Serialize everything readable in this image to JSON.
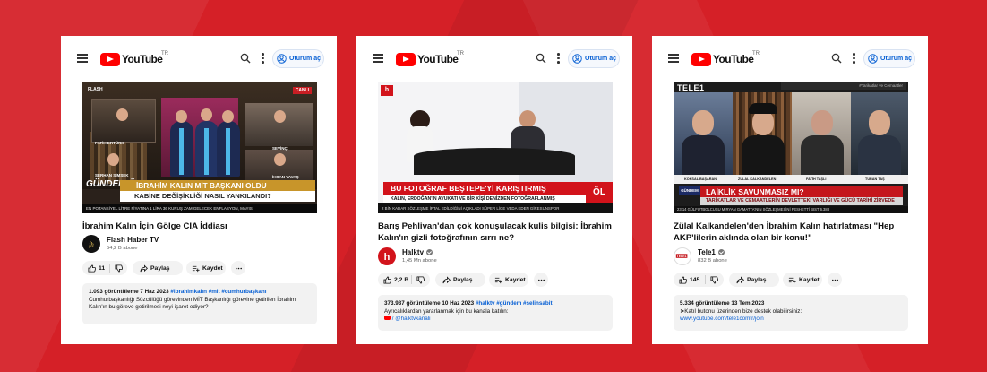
{
  "colors": {
    "background": "#d52027",
    "yt_red": "#ff0000",
    "link_blue": "#065fd4"
  },
  "icons": [
    "menu-icon",
    "youtube-logo",
    "search-icon",
    "kebab-icon",
    "account-icon",
    "like-icon",
    "dislike-icon",
    "share-icon",
    "save-icon",
    "more-icon",
    "verified-icon"
  ],
  "cards": [
    {
      "header": {
        "logo": "YouTube",
        "tld": "TR",
        "signin": "Oturum aç"
      },
      "thumbnail": {
        "brand": "FLASH",
        "live": "CANLI",
        "person1": "FATİH ERTÜRK",
        "person2": "SEVİNÇ",
        "person3": "SERHAN ŞİMŞEK",
        "person4": "İHSAN YAVAŞ",
        "show": "GÜNDEM ÖZEL",
        "headline": "İBRAHİM KALIN MİT BAŞKANI OLDU",
        "subheadline": "KABİNE DEĞİŞİKLİĞİ NASIL YANKILANDI?",
        "ticker": "EN POTANSİYEL LİTRE FİYATINA 1 LİRA 36 KURUŞ ZAM GELECEK   ENFLASYON, MAYIS"
      },
      "title": "İbrahim Kalın İçin Gölge CIA İddiası",
      "channel": {
        "name": "Flash Haber TV",
        "subs": "54,2 B abone",
        "verified": false
      },
      "actions": {
        "likes": "11",
        "share": "Paylaş",
        "save": "Kaydet"
      },
      "description": {
        "meta": "1.093 görüntüleme  7 Haz 2023",
        "tags": "#ibrahimkalın #mit #cumhurbaşkanı",
        "lines": [
          "Cumhurbaşkanlığı Sözcülüğü görevinden MİT Başkanlığı görevine getirilen İbrahim",
          "Kalın'ın bu göreve getirilmesi neyi işaret ediyor?"
        ],
        "link": ""
      }
    },
    {
      "header": {
        "logo": "YouTube",
        "tld": "TR",
        "signin": "Oturum aç"
      },
      "thumbnail": {
        "logo": "h",
        "headline": "BU FOTOĞRAF BEŞTEPE'Yİ KARIŞTIRMIŞ",
        "subheadline": "KALIN, ERDOĞAN'IN AVUKATI VE BİR KİŞİ DENİZDEN FOTOĞRAFLANMIŞ",
        "side": "ÖL",
        "ticker": "2 BİN KADAR SÖZLEŞME İPTAL EDİLDİĞİNİ AÇIKLADI   SÜPER LİGE VEDA EDEN GİRESUNSPOR"
      },
      "title": "Barış Pehlivan'dan çok konuşulacak kulis bilgisi: İbrahim Kalın'ın gizli fotoğrafının sırrı ne?",
      "channel": {
        "name": "Halktv",
        "subs": "1,45 Mn abone",
        "verified": true
      },
      "actions": {
        "likes": "2,2 B",
        "share": "Paylaş",
        "save": "Kaydet"
      },
      "description": {
        "meta": "373.937 görüntüleme  10 Haz 2023",
        "tags": "#halktv #gündem #selinsabit",
        "lines": [
          "Ayrıcalıklardan yararlanmak için bu kanala katılın:"
        ],
        "link": "/ @halktvkanali"
      }
    },
    {
      "header": {
        "logo": "YouTube",
        "tld": "TR",
        "signin": "Oturum aç"
      },
      "thumbnail": {
        "logo": "TELE1",
        "topbar": "#Tarikatlar ve Cemaatler",
        "names": [
          "KÖKSAL BAŞARAN",
          "ZÜLAL KALKANDELEN",
          "FATİH TAŞLI",
          "TURAN TAŞ"
        ],
        "tag": "GÜNDEM",
        "headline": "LAİKLİK SAVUNMASIZ MI?",
        "subheadline": "TARİKATLAR VE CEMAATLERİN DEVLETTEKİ VARLIĞI VE GÜCÜ TARİHİ ZİRVEDE",
        "ticker": "23.14   GÜLFUTBOLCUSU MİRYAN GAMATTA'NIN SÖZLEŞMESİNİ FESHETTİ   BIST 6.388"
      },
      "title": "Zülal Kalkandelen'den İbrahim Kalın hatırlatması \"Hep AKP'lilerin aklında olan bir konu!\"",
      "channel": {
        "name": "Tele1",
        "subs": "832 B abone",
        "verified": true
      },
      "actions": {
        "likes": "145",
        "share": "Paylaş",
        "save": "Kaydet"
      },
      "description": {
        "meta": "5.334 görüntüleme  13 Tem 2023",
        "tags": "",
        "lines": [
          "➤Katıl butonu üzerinden bize destek olabilirsiniz:"
        ],
        "link": "www.youtube.com/tele1comtr/join"
      }
    }
  ]
}
